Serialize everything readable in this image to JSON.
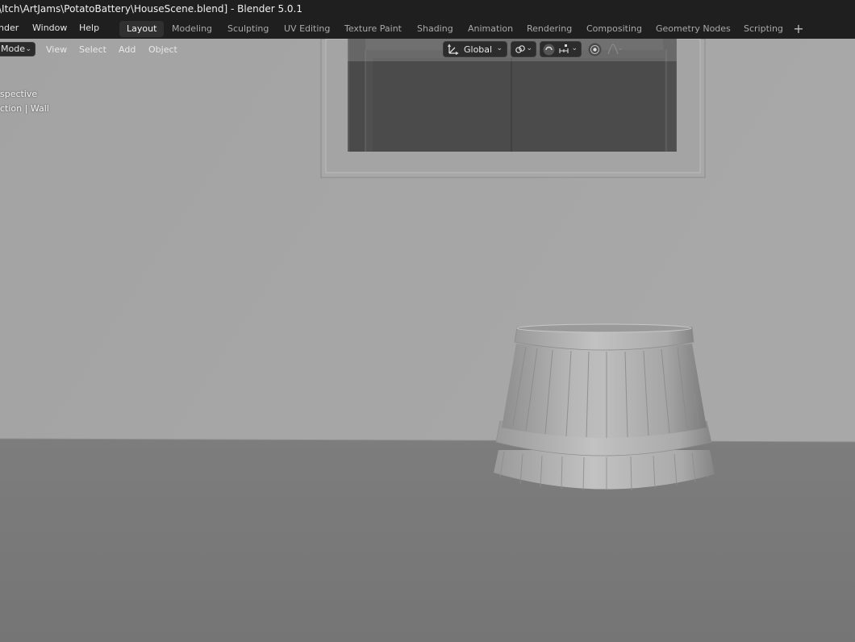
{
  "window": {
    "title": "\\Itch\\ArtJams\\PotatoBattery\\HouseScene.blend] - Blender 5.0.1"
  },
  "menubar": {
    "items": [
      "nder",
      "Window",
      "Help"
    ],
    "workspaces": [
      "Layout",
      "Modeling",
      "Sculpting",
      "UV Editing",
      "Texture Paint",
      "Shading",
      "Animation",
      "Rendering",
      "Compositing",
      "Geometry Nodes",
      "Scripting"
    ],
    "active_workspace": "Layout",
    "add_tab_glyph": "+"
  },
  "viewport_header": {
    "mode_label": "Mode",
    "menus": [
      "View",
      "Select",
      "Add",
      "Object"
    ],
    "orientation": "Global"
  },
  "viewport_overlay": {
    "line1": "spective",
    "line2": "ction | Wall"
  },
  "icons": {
    "orientation": "transform-orientation-icon",
    "pivot": "link-icon",
    "snap": "magnet-icon",
    "snap_target": "snap-increment-icon",
    "proportional": "proportional-edit-icon",
    "falloff": "falloff-curve-icon"
  },
  "colors": {
    "ui_dark": "#1f1f1f",
    "active_tab": "#303030",
    "wall": "#a7a7a7",
    "floor": "#7a7a7a"
  }
}
